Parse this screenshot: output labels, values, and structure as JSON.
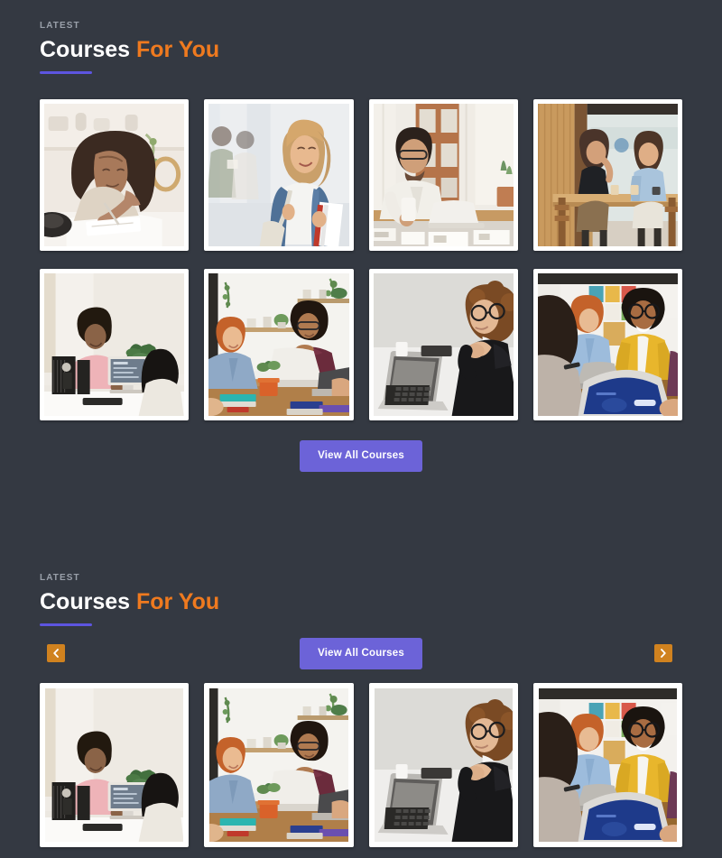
{
  "theme": {
    "background": "#343942",
    "card_bg": "#ffffff",
    "accent_orange": "#ef7a1f",
    "accent_purple": "#5d55e0",
    "button_purple": "#6c63d8",
    "arrow_orange": "#d0821f",
    "eyebrow_gray": "#9aa0aa"
  },
  "sections": [
    {
      "eyebrow": "LATEST",
      "title_part1": "Courses",
      "title_part2": "For You",
      "button_label": "View All Courses",
      "rows": [
        {
          "cards": [
            {
              "alt": "woman-writing-in-notebook",
              "scene": "writing-desk"
            },
            {
              "alt": "student-with-backpack-and-books",
              "scene": "student-hallway"
            },
            {
              "alt": "man-with-laptop-and-coffee-at-window",
              "scene": "man-window-desk"
            },
            {
              "alt": "two-women-talking-at-cafe-table",
              "scene": "cafe-table"
            }
          ]
        },
        {
          "cards": [
            {
              "alt": "woman-at-office-desk-with-imac",
              "scene": "office-imac"
            },
            {
              "alt": "three-colleagues-with-laptops-at-table",
              "scene": "team-table"
            },
            {
              "alt": "woman-with-glasses-thinking-at-laptop",
              "scene": "woman-laptop"
            },
            {
              "alt": "team-meeting-with-tablet-and-laptop",
              "scene": "meeting-tablet"
            }
          ]
        }
      ]
    },
    {
      "eyebrow": "LATEST",
      "title_part1": "Courses",
      "title_part2": "For You",
      "button_label": "View All Courses",
      "prev_label": "‹",
      "next_label": "›",
      "prev_icon": "chevron-left-icon",
      "next_icon": "chevron-right-icon",
      "rows": [
        {
          "cards": [
            {
              "alt": "woman-at-office-desk-with-imac",
              "scene": "office-imac"
            },
            {
              "alt": "three-colleagues-with-laptops-at-table",
              "scene": "team-table"
            },
            {
              "alt": "woman-with-glasses-thinking-at-laptop",
              "scene": "woman-laptop"
            },
            {
              "alt": "team-meeting-with-tablet-and-laptop",
              "scene": "meeting-tablet"
            }
          ]
        }
      ]
    }
  ]
}
